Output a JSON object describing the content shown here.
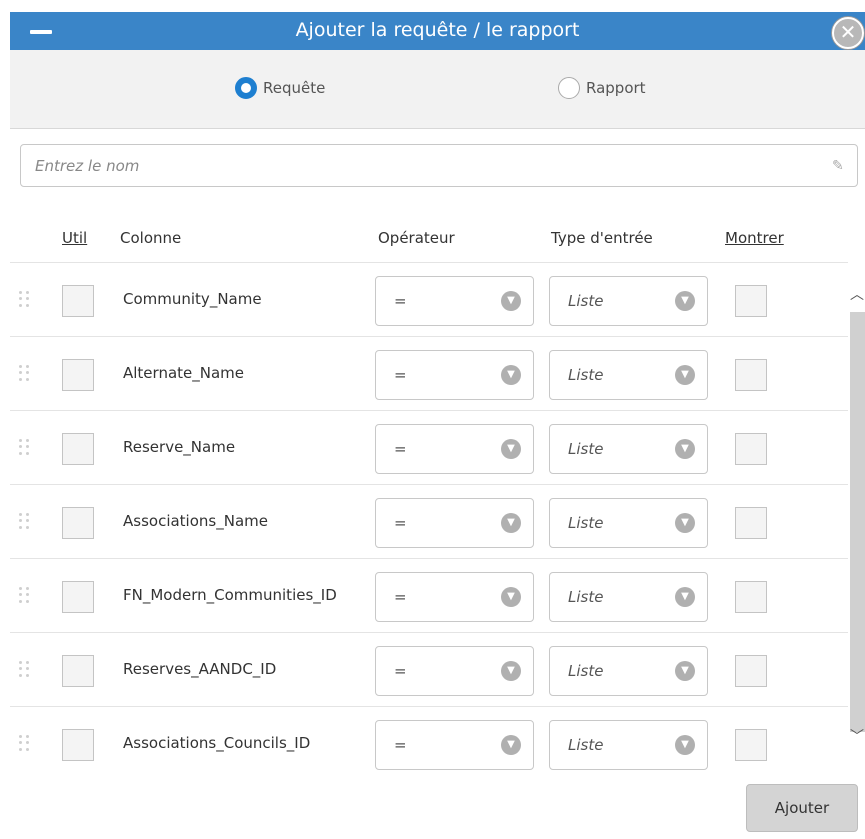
{
  "dialog": {
    "title": "Ajouter la requête / le rapport",
    "close_glyph": "✕"
  },
  "mode": {
    "options": [
      {
        "label": "Requête",
        "selected": true
      },
      {
        "label": "Rapport",
        "selected": false
      }
    ]
  },
  "name_field": {
    "placeholder": "Entrez le nom",
    "value": "",
    "edit_icon": "pencil-icon"
  },
  "table": {
    "headers": {
      "use": "Util",
      "column": "Colonne",
      "operator": "Opérateur",
      "input_type": "Type d'entrée",
      "show": "Montrer"
    },
    "rows": [
      {
        "column": "Community_Name",
        "operator": "=",
        "input_type": "Liste",
        "use": false,
        "show": false
      },
      {
        "column": "Alternate_Name",
        "operator": "=",
        "input_type": "Liste",
        "use": false,
        "show": false
      },
      {
        "column": "Reserve_Name",
        "operator": "=",
        "input_type": "Liste",
        "use": false,
        "show": false
      },
      {
        "column": "Associations_Name",
        "operator": "=",
        "input_type": "Liste",
        "use": false,
        "show": false
      },
      {
        "column": "FN_Modern_Communities_ID",
        "operator": "=",
        "input_type": "Liste",
        "use": false,
        "show": false
      },
      {
        "column": "Reserves_AANDC_ID",
        "operator": "=",
        "input_type": "Liste",
        "use": false,
        "show": false
      },
      {
        "column": "Associations_Councils_ID",
        "operator": "=",
        "input_type": "Liste",
        "use": false,
        "show": false
      }
    ]
  },
  "actions": {
    "add_label": "Ajouter"
  },
  "colors": {
    "titlebar": "#3a85c8",
    "radio_selected": "#1e7fd0",
    "button": "#d4d4d4"
  }
}
